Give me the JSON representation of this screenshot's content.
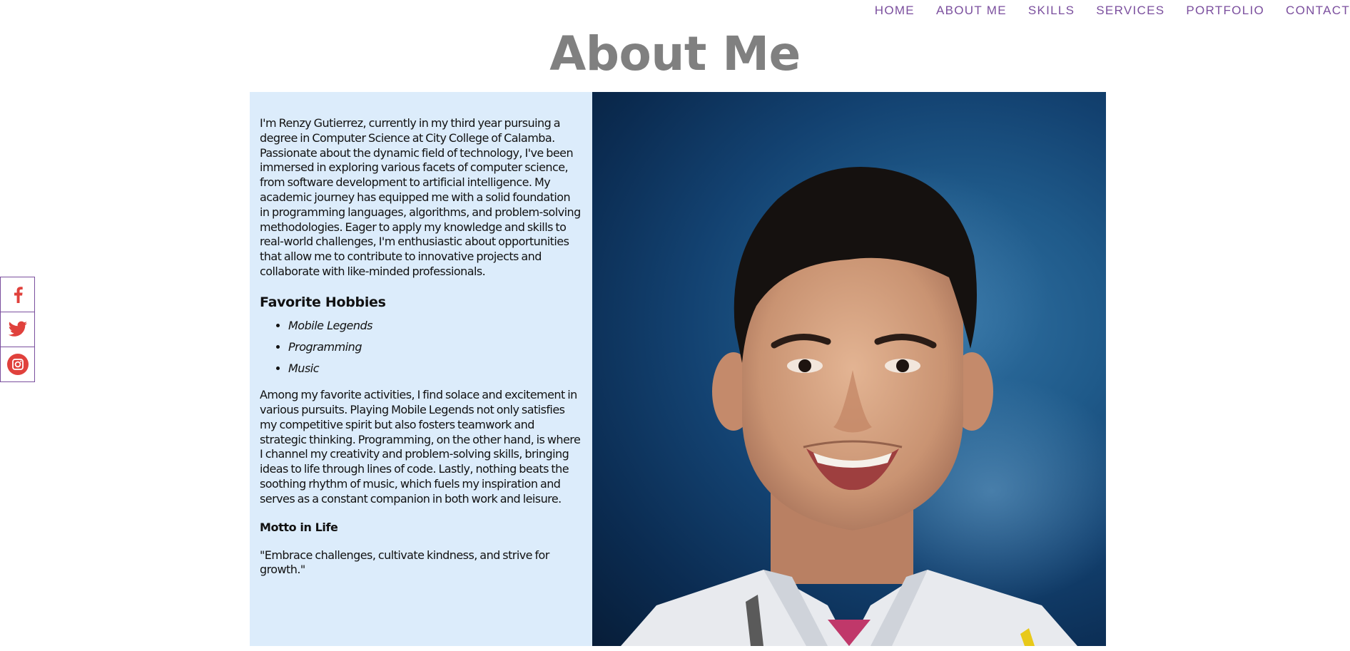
{
  "nav": {
    "items": [
      {
        "label": "HOME"
      },
      {
        "label": "ABOUT ME"
      },
      {
        "label": "SKILLS"
      },
      {
        "label": "SERVICES"
      },
      {
        "label": "PORTFOLIO"
      },
      {
        "label": "CONTACT"
      }
    ]
  },
  "page": {
    "title": "About Me"
  },
  "about": {
    "intro": "I'm Renzy Gutierrez, currently in my third year pursuing a degree in Computer Science at City College of Calamba. Passionate about the dynamic field of technology, I've been immersed in exploring various facets of computer science, from software development to artificial intelligence. My academic journey has equipped me with a solid foundation in programming languages, algorithms, and problem-solving methodologies. Eager to apply my knowledge and skills to real-world challenges, I'm enthusiastic about opportunities that allow me to contribute to innovative projects and collaborate with like-minded professionals.",
    "hobbies_heading": "Favorite Hobbies",
    "hobbies": [
      "Mobile Legends",
      "Programming",
      "Music"
    ],
    "hobbies_text": "Among my favorite activities, I find solace and excitement in various pursuits. Playing Mobile Legends not only satisfies my competitive spirit but also fosters teamwork and strategic thinking. Programming, on the other hand, is where I channel my creativity and problem-solving skills, bringing ideas to life through lines of code. Lastly, nothing beats the soothing rhythm of music, which fuels my inspiration and serves as a constant companion in both work and leisure.",
    "motto_heading": "Motto in Life",
    "motto": "\"Embrace challenges, cultivate kindness, and strive for growth.\""
  },
  "social": {
    "items": [
      {
        "icon": "facebook-icon"
      },
      {
        "icon": "twitter-icon"
      },
      {
        "icon": "instagram-icon"
      }
    ]
  },
  "colors": {
    "nav_text": "#7b4f9e",
    "title": "#808080",
    "text_panel_bg": "#dcecfb",
    "social_icon": "#e0413c",
    "social_border": "#7b4f9e"
  }
}
